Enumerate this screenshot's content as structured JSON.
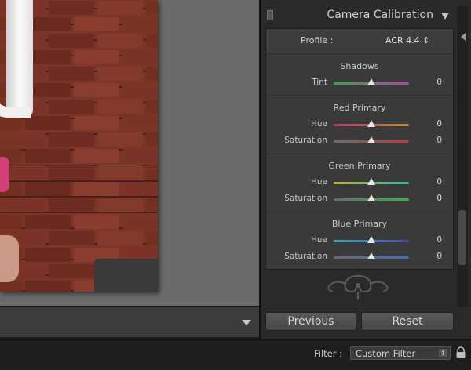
{
  "panel": {
    "title": "Camera Calibration",
    "profile_label": "Profile :",
    "profile_value": "ACR 4.4 ↕"
  },
  "sections": [
    {
      "title": "Shadows",
      "sliders": [
        {
          "label": "Tint",
          "value": "0",
          "position": 0.5,
          "track_colors": [
            "#3aa840",
            "#b040b0"
          ]
        }
      ]
    },
    {
      "title": "Red Primary",
      "sliders": [
        {
          "label": "Hue",
          "value": "0",
          "position": 0.5,
          "track_colors": [
            "#b03a6a",
            "#c08a3a"
          ]
        },
        {
          "label": "Saturation",
          "value": "0",
          "position": 0.5,
          "track_colors": [
            "#6a6a6a",
            "#c03a3a"
          ]
        }
      ]
    },
    {
      "title": "Green Primary",
      "sliders": [
        {
          "label": "Hue",
          "value": "0",
          "position": 0.5,
          "track_colors": [
            "#c0b03a",
            "#3ab0a0"
          ]
        },
        {
          "label": "Saturation",
          "value": "0",
          "position": 0.5,
          "track_colors": [
            "#6a6a6a",
            "#3ab050"
          ]
        }
      ]
    },
    {
      "title": "Blue Primary",
      "sliders": [
        {
          "label": "Hue",
          "value": "0",
          "position": 0.5,
          "track_colors": [
            "#3ab0b0",
            "#5040b0"
          ]
        },
        {
          "label": "Saturation",
          "value": "0",
          "position": 0.5,
          "track_colors": [
            "#6a6a6a",
            "#3a70c0"
          ]
        }
      ]
    }
  ],
  "buttons": {
    "previous": "Previous",
    "reset": "Reset"
  },
  "filter": {
    "label": "Filter :",
    "value": "Custom Filter"
  },
  "icons": {
    "panel_toggle": "panel-toggle-icon",
    "collapse": "triangle-down-icon",
    "filmstrip_menu": "triangle-down-icon",
    "ornament": "panel-end-ornament-icon",
    "lock": "lock-icon"
  }
}
